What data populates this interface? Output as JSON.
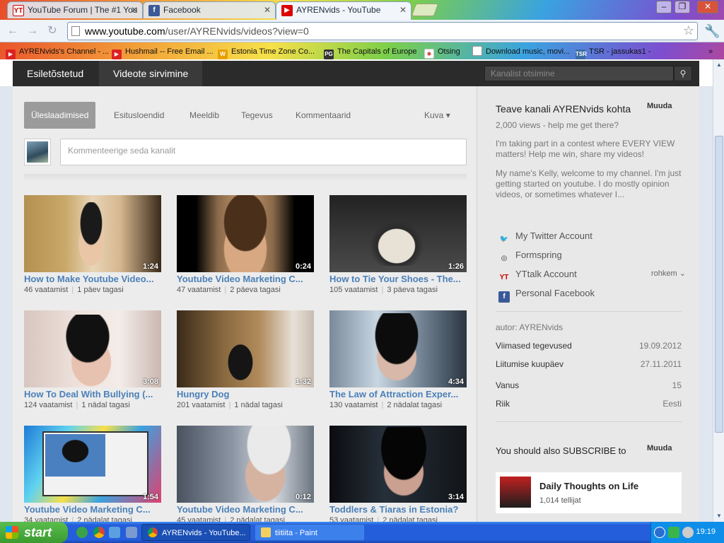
{
  "browser": {
    "tabs": [
      {
        "title": "YouTube Forum | The #1 You",
        "icon": "yt-forum-icon"
      },
      {
        "title": "Facebook",
        "icon": "facebook-icon"
      },
      {
        "title": "AYRENvids - YouTube",
        "icon": "youtube-icon",
        "active": true
      }
    ],
    "url_host": "www.youtube.com",
    "url_path": "/user/AYRENvids/videos?view=0",
    "bookmarks": [
      {
        "label": "AYRENvids's Channel - ...",
        "color": "#d22"
      },
      {
        "label": "Hushmail -- Free Email ...",
        "color": "#d22"
      },
      {
        "label": "Estonia Time Zone Co...",
        "color": "#e8a000"
      },
      {
        "label": "The Capitals of Europe",
        "color": "#333"
      },
      {
        "label": "Otsing",
        "color": "#c33"
      },
      {
        "label": "Download music, movi...",
        "color": "#999"
      },
      {
        "label": "TSR - jassukas1 -",
        "color": "#3a6ea5"
      }
    ]
  },
  "channel_bar": {
    "tabs": [
      "Esiletõstetud",
      "Videote sirvimine"
    ],
    "search_placeholder": "Kanalist otsimine"
  },
  "page_tabs": [
    "Üleslaadimised",
    "Esitusloendid",
    "Meeldib",
    "Tegevus",
    "Kommentaarid"
  ],
  "view_label": "Kuva",
  "comment_placeholder": "Kommenteerige seda kanalit",
  "videos": [
    {
      "title": "How to Make Youtube Video...",
      "views": "46 vaatamist",
      "age": "1 päev tagasi",
      "duration": "1:24"
    },
    {
      "title": "Youtube Video Marketing C...",
      "views": "47 vaatamist",
      "age": "2 päeva tagasi",
      "duration": "0:24"
    },
    {
      "title": "How to Tie Your Shoes - The...",
      "views": "105 vaatamist",
      "age": "3 päeva tagasi",
      "duration": "1:26"
    },
    {
      "title": "How To Deal With Bullying (...",
      "views": "124 vaatamist",
      "age": "1 nädal tagasi",
      "duration": "3:08"
    },
    {
      "title": "Hungry Dog",
      "views": "201 vaatamist",
      "age": "1 nädal tagasi",
      "duration": "1:32"
    },
    {
      "title": "The Law of Attraction Exper...",
      "views": "130 vaatamist",
      "age": "2 nädalat tagasi",
      "duration": "4:34"
    },
    {
      "title": "Youtube Video Marketing C...",
      "views": "34 vaatamist",
      "age": "2 nädalat tagasi",
      "duration": "1:54"
    },
    {
      "title": "Youtube Video Marketing C...",
      "views": "45 vaatamist",
      "age": "2 nädalat tagasi",
      "duration": "0:12"
    },
    {
      "title": "Toddlers & Tiaras in Estonia?",
      "views": "53 vaatamist",
      "age": "2 nädalat tagasi",
      "duration": "3:14"
    }
  ],
  "about": {
    "title": "Teave kanali AYRENvids kohta",
    "edit": "Muuda",
    "line1": "2,000 views - help me get there?",
    "line2": "I'm taking part in a contest where EVERY VIEW matters! Help me win, share my videos!",
    "line3": "My name's Kelly, welcome to my channel. I'm just getting started on youtube. I do mostly opinion videos, or sometimes whatever I...",
    "more": "rohkem",
    "links": [
      {
        "label": "My Twitter Account",
        "icon": "twitter-icon"
      },
      {
        "label": "Formspring",
        "icon": "formspring-icon"
      },
      {
        "label": "YTtalk Account",
        "icon": "yttalk-icon"
      },
      {
        "label": "Personal Facebook",
        "icon": "facebook-icon"
      }
    ],
    "author": "autor: AYRENvids",
    "info": [
      {
        "key": "Viimased tegevused",
        "value": "19.09.2012"
      },
      {
        "key": "Liitumise kuupäev",
        "value": "27.11.2011"
      },
      {
        "key": "Vanus",
        "value": "15"
      },
      {
        "key": "Riik",
        "value": "Eesti"
      }
    ]
  },
  "subscribe": {
    "title": "You should also SUBSCRIBE to",
    "edit": "Muuda",
    "channel_name": "Daily Thoughts on Life",
    "subscribers": "1,014 tellijat"
  },
  "taskbar": {
    "start": "start",
    "tasks": [
      "AYRENvids - YouTube...",
      "tiitiita - Paint"
    ],
    "clock": "19:19"
  }
}
